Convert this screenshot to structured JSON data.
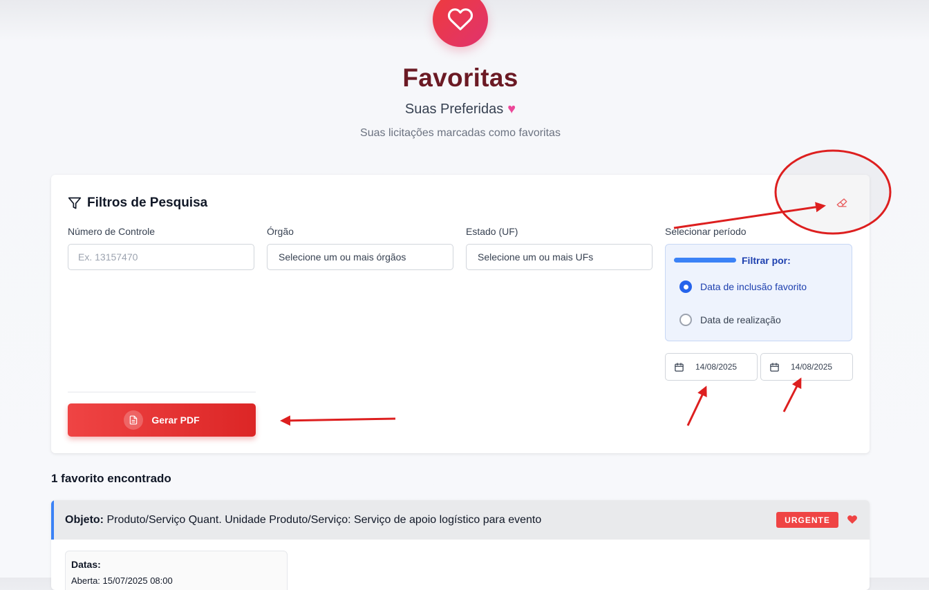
{
  "header": {
    "title": "Favoritas",
    "subtitle": "Suas Preferidas",
    "description": "Suas licitações marcadas como favoritas"
  },
  "filters": {
    "title": "Filtros de Pesquisa",
    "control_number": {
      "label": "Número de Controle",
      "placeholder": "Ex. 13157470"
    },
    "organ": {
      "label": "Órgão",
      "value": "Selecione um ou mais órgãos"
    },
    "state": {
      "label": "Estado (UF)",
      "value": "Selecione um ou mais UFs"
    },
    "period": {
      "label": "Selecionar período",
      "filter_by": "Filtrar por:",
      "options": [
        "Data de inclusão favorito",
        "Data de realização"
      ],
      "selected": "Data de inclusão favorito",
      "start_date": "14/08/2025",
      "end_date": "14/08/2025"
    },
    "pdf_button": "Gerar PDF"
  },
  "results": {
    "count_text": "1 favorito encontrado",
    "items": [
      {
        "object_label": "Objeto:",
        "object_text": "Produto/Serviço Quant. Unidade Produto/Serviço: Serviço de apoio logístico para evento",
        "badge": "URGENTE",
        "dates_label": "Datas:",
        "dates_value": "Aberta: 15/07/2025 08:00"
      }
    ]
  },
  "colors": {
    "title": "#6b1a24",
    "primary_red": "#ef4444",
    "accent_blue": "#3b82f6",
    "annotation_red": "#dd1f1f"
  },
  "icons": [
    "heart-icon",
    "filter-icon",
    "eraser-icon",
    "calendar-icon",
    "document-icon"
  ]
}
